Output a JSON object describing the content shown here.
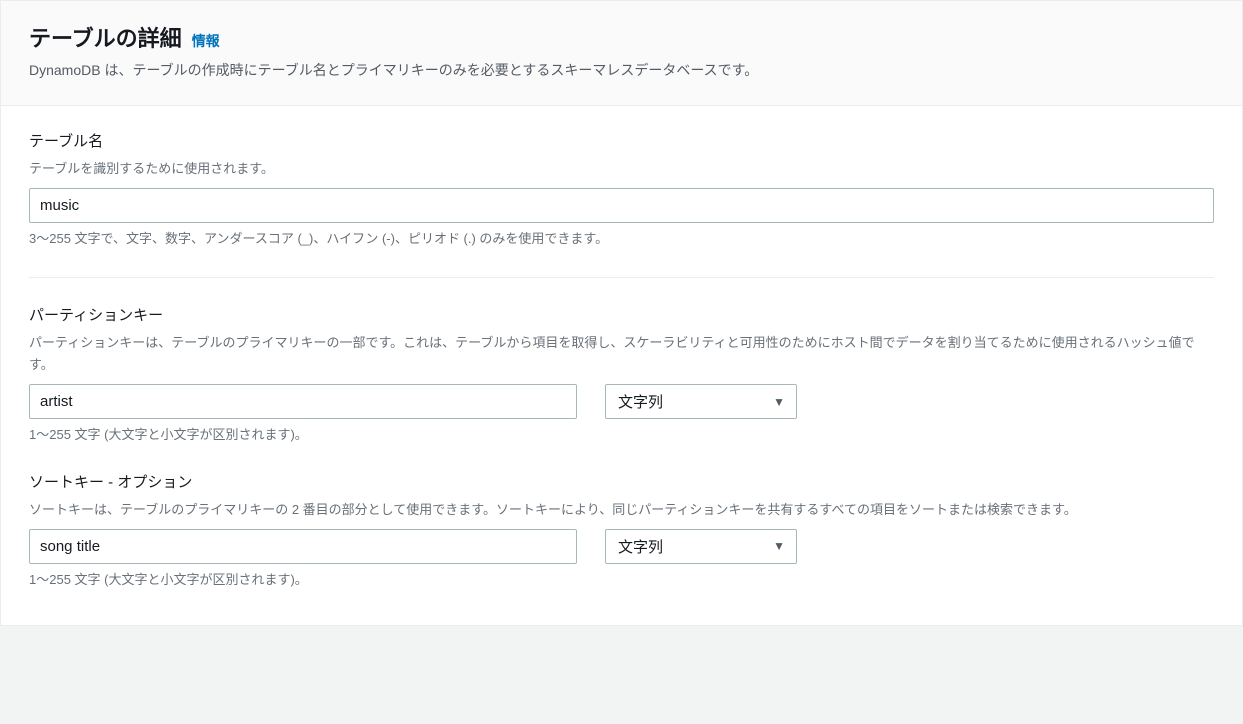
{
  "header": {
    "title": "テーブルの詳細",
    "info_link": "情報",
    "subtitle": "DynamoDB は、テーブルの作成時にテーブル名とプライマリキーのみを必要とするスキーマレスデータベースです。"
  },
  "table_name": {
    "label": "テーブル名",
    "help": "テーブルを識別するために使用されます。",
    "value": "music",
    "hint": "3〜255 文字で、文字、数字、アンダースコア (_)、ハイフン (-)、ピリオド (.) のみを使用できます。"
  },
  "partition_key": {
    "label": "パーティションキー",
    "help": "パーティションキーは、テーブルのプライマリキーの一部です。これは、テーブルから項目を取得し、スケーラビリティと可用性のためにホスト間でデータを割り当てるために使用されるハッシュ値です。",
    "value": "artist",
    "type_selected": "文字列",
    "hint": "1〜255 文字 (大文字と小文字が区別されます)。"
  },
  "sort_key": {
    "label": "ソートキー - オプション",
    "help": "ソートキーは、テーブルのプライマリキーの 2 番目の部分として使用できます。ソートキーにより、同じパーティションキーを共有するすべての項目をソートまたは検索できます。",
    "value": "song title",
    "type_selected": "文字列",
    "hint": "1〜255 文字 (大文字と小文字が区別されます)。"
  }
}
